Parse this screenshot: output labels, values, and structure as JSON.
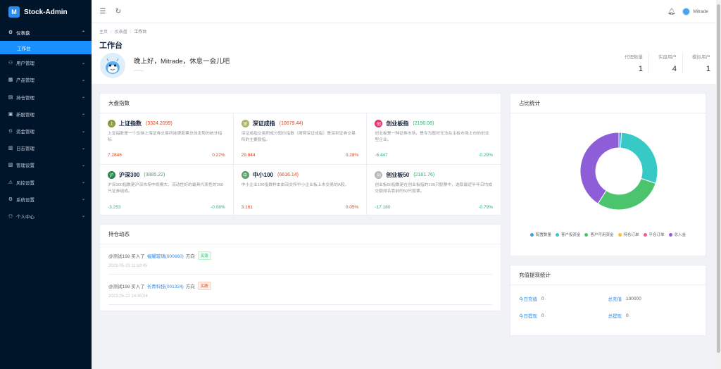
{
  "app": {
    "name": "Stock-Admin",
    "logo_letter": "M"
  },
  "sidebar": {
    "items": [
      {
        "label": "仪表盘",
        "icon": "gauge-icon",
        "glyph": "⚙",
        "open": true
      },
      {
        "label": "用户管理",
        "icon": "user-icon",
        "glyph": "⚇"
      },
      {
        "label": "产品管理",
        "icon": "product-icon",
        "glyph": "▦"
      },
      {
        "label": "持仓管理",
        "icon": "position-icon",
        "glyph": "▤"
      },
      {
        "label": "新股管理",
        "icon": "new-stock-icon",
        "glyph": "▣"
      },
      {
        "label": "资金管理",
        "icon": "funds-icon",
        "glyph": "⊙"
      },
      {
        "label": "日志管理",
        "icon": "log-icon",
        "glyph": "▥"
      },
      {
        "label": "管理设置",
        "icon": "admin-settings-icon",
        "glyph": "▧"
      },
      {
        "label": "风控设置",
        "icon": "risk-icon",
        "glyph": "⚠"
      },
      {
        "label": "系统设置",
        "icon": "system-settings-icon",
        "glyph": "⚙"
      },
      {
        "label": "个人中心",
        "icon": "profile-icon",
        "glyph": "⚇"
      }
    ],
    "sub_item": "工作台"
  },
  "header": {
    "username": "Mitrade"
  },
  "breadcrumb": {
    "home": "主页",
    "dashboard": "仪表盘",
    "current": "工作台"
  },
  "page": {
    "title": "工作台",
    "greeting": "晚上好，Mitrade，休息一会儿吧",
    "greeting_sub": "——",
    "stats": [
      {
        "label": "代理数量",
        "value": "1"
      },
      {
        "label": "实盘用户",
        "value": "4"
      },
      {
        "label": "模拟用户",
        "value": "1"
      }
    ]
  },
  "market": {
    "title": "大盘指数",
    "indices": [
      {
        "name": "上证指数",
        "value": "(3324.2099)",
        "icon_text": "上",
        "icon_color": "#8a9a3a",
        "value_color": "#ed4014",
        "desc": "上证指数是一个反映上海证券交易所挂牌股票总体走势的统计指标",
        "change": "7.2846",
        "pct": "0.22%",
        "dir": "up"
      },
      {
        "name": "深证成指",
        "value": "(10679.44)",
        "icon_text": "深",
        "icon_color": "#b0b46a",
        "value_color": "#ed4014",
        "desc": "深证成指交易所成分股价指数（简称深证成指）是深圳证券交易所的主要股指。",
        "change": "29.844",
        "pct": "0.28%",
        "dir": "up"
      },
      {
        "name": "创业板指",
        "value": "(2190.08)",
        "icon_text": "创",
        "icon_color": "#e6356e",
        "value_color": "#19be6b",
        "desc": "创业板是一种证券市场，是专为暂时无法在主板市场上市的创业型企业。",
        "change": "-6.447",
        "pct": "-0.29%",
        "dir": "down"
      },
      {
        "name": "沪深300",
        "value": "(3885.22)",
        "icon_text": "沪",
        "icon_color": "#1f8a4c",
        "value_color": "#19be6b",
        "desc": "沪深300指数是沪深市场中规模大、流动性好的最具代表性的300只证券组成。",
        "change": "-3.253",
        "pct": "-0.08%",
        "dir": "down"
      },
      {
        "name": "中小100",
        "value": "(6616.14)",
        "icon_text": "中",
        "icon_color": "#58a36b",
        "value_color": "#ed4014",
        "desc": "中小企业100指数样本由深交所中小企业板上市交易的A股。",
        "change": "3.161",
        "pct": "0.05%",
        "dir": "up"
      },
      {
        "name": "创业板50",
        "value": "(2161.76)",
        "icon_text": "创",
        "icon_color": "#b8b8b8",
        "value_color": "#19be6b",
        "desc": "创业板50指数是在创业板指的100只股票中，选取最近半年日均成交额排名靠前的50只股票。",
        "change": "-17.180",
        "pct": "-0.79%",
        "dir": "down"
      }
    ]
  },
  "positions": {
    "title": "持仓动态",
    "items": [
      {
        "user": "@测试198",
        "action": "买入了",
        "stock": "福耀玻璃(600660)",
        "dir_label": "方向",
        "tag": "买涨",
        "tag_type": "buy",
        "time": "2023-05-23 11:19:45"
      },
      {
        "user": "@测试198",
        "action": "买入了",
        "stock": "长青科技(001324)",
        "dir_label": "方向",
        "tag": "买跌",
        "tag_type": "sell",
        "time": "2023-05-22 14:35:04"
      }
    ]
  },
  "ratio": {
    "title": "占比统计",
    "legend": [
      {
        "label": "配置数量",
        "color": "#3ba1e0"
      },
      {
        "label": "客户投资金",
        "color": "#36c9c6"
      },
      {
        "label": "客户可用资金",
        "color": "#4cc46e"
      },
      {
        "label": "持仓订单",
        "color": "#f6c141"
      },
      {
        "label": "平仓订单",
        "color": "#f25d7e"
      },
      {
        "label": "总入金",
        "color": "#8e5ed9"
      }
    ]
  },
  "chart_data": {
    "type": "pie",
    "categories": [
      "配置数量",
      "客户投资金",
      "客户可用资金",
      "持仓订单",
      "平仓订单",
      "总入金"
    ],
    "values": [
      1,
      27,
      27,
      0,
      0,
      38
    ],
    "colors": [
      "#3ba1e0",
      "#36c9c6",
      "#4cc46e",
      "#f6c141",
      "#f25d7e",
      "#8e5ed9"
    ]
  },
  "recharge": {
    "title": "充值提现统计",
    "cells": [
      {
        "label": "今日充值",
        "value": "0"
      },
      {
        "label": "总充值",
        "value": "100000"
      },
      {
        "label": "今日提现",
        "value": "0"
      },
      {
        "label": "总提现",
        "value": "0"
      }
    ]
  }
}
